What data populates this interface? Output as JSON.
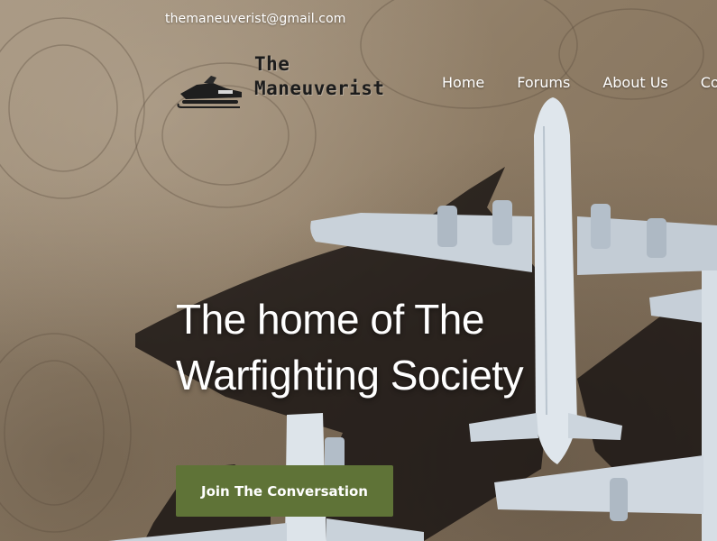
{
  "header": {
    "email": "themaneuverist@gmail.com",
    "logo_line1": "The",
    "logo_line2": "Maneuverist"
  },
  "nav": {
    "items": [
      {
        "label": "Home"
      },
      {
        "label": "Forums"
      },
      {
        "label": "About Us"
      },
      {
        "label": "Co"
      }
    ]
  },
  "hero": {
    "headline_line1": "The home of The",
    "headline_line2": "Warfighting Society",
    "cta_label": "Join The Conversation"
  },
  "colors": {
    "cta_background": "#5f7337",
    "text": "#ffffff"
  }
}
